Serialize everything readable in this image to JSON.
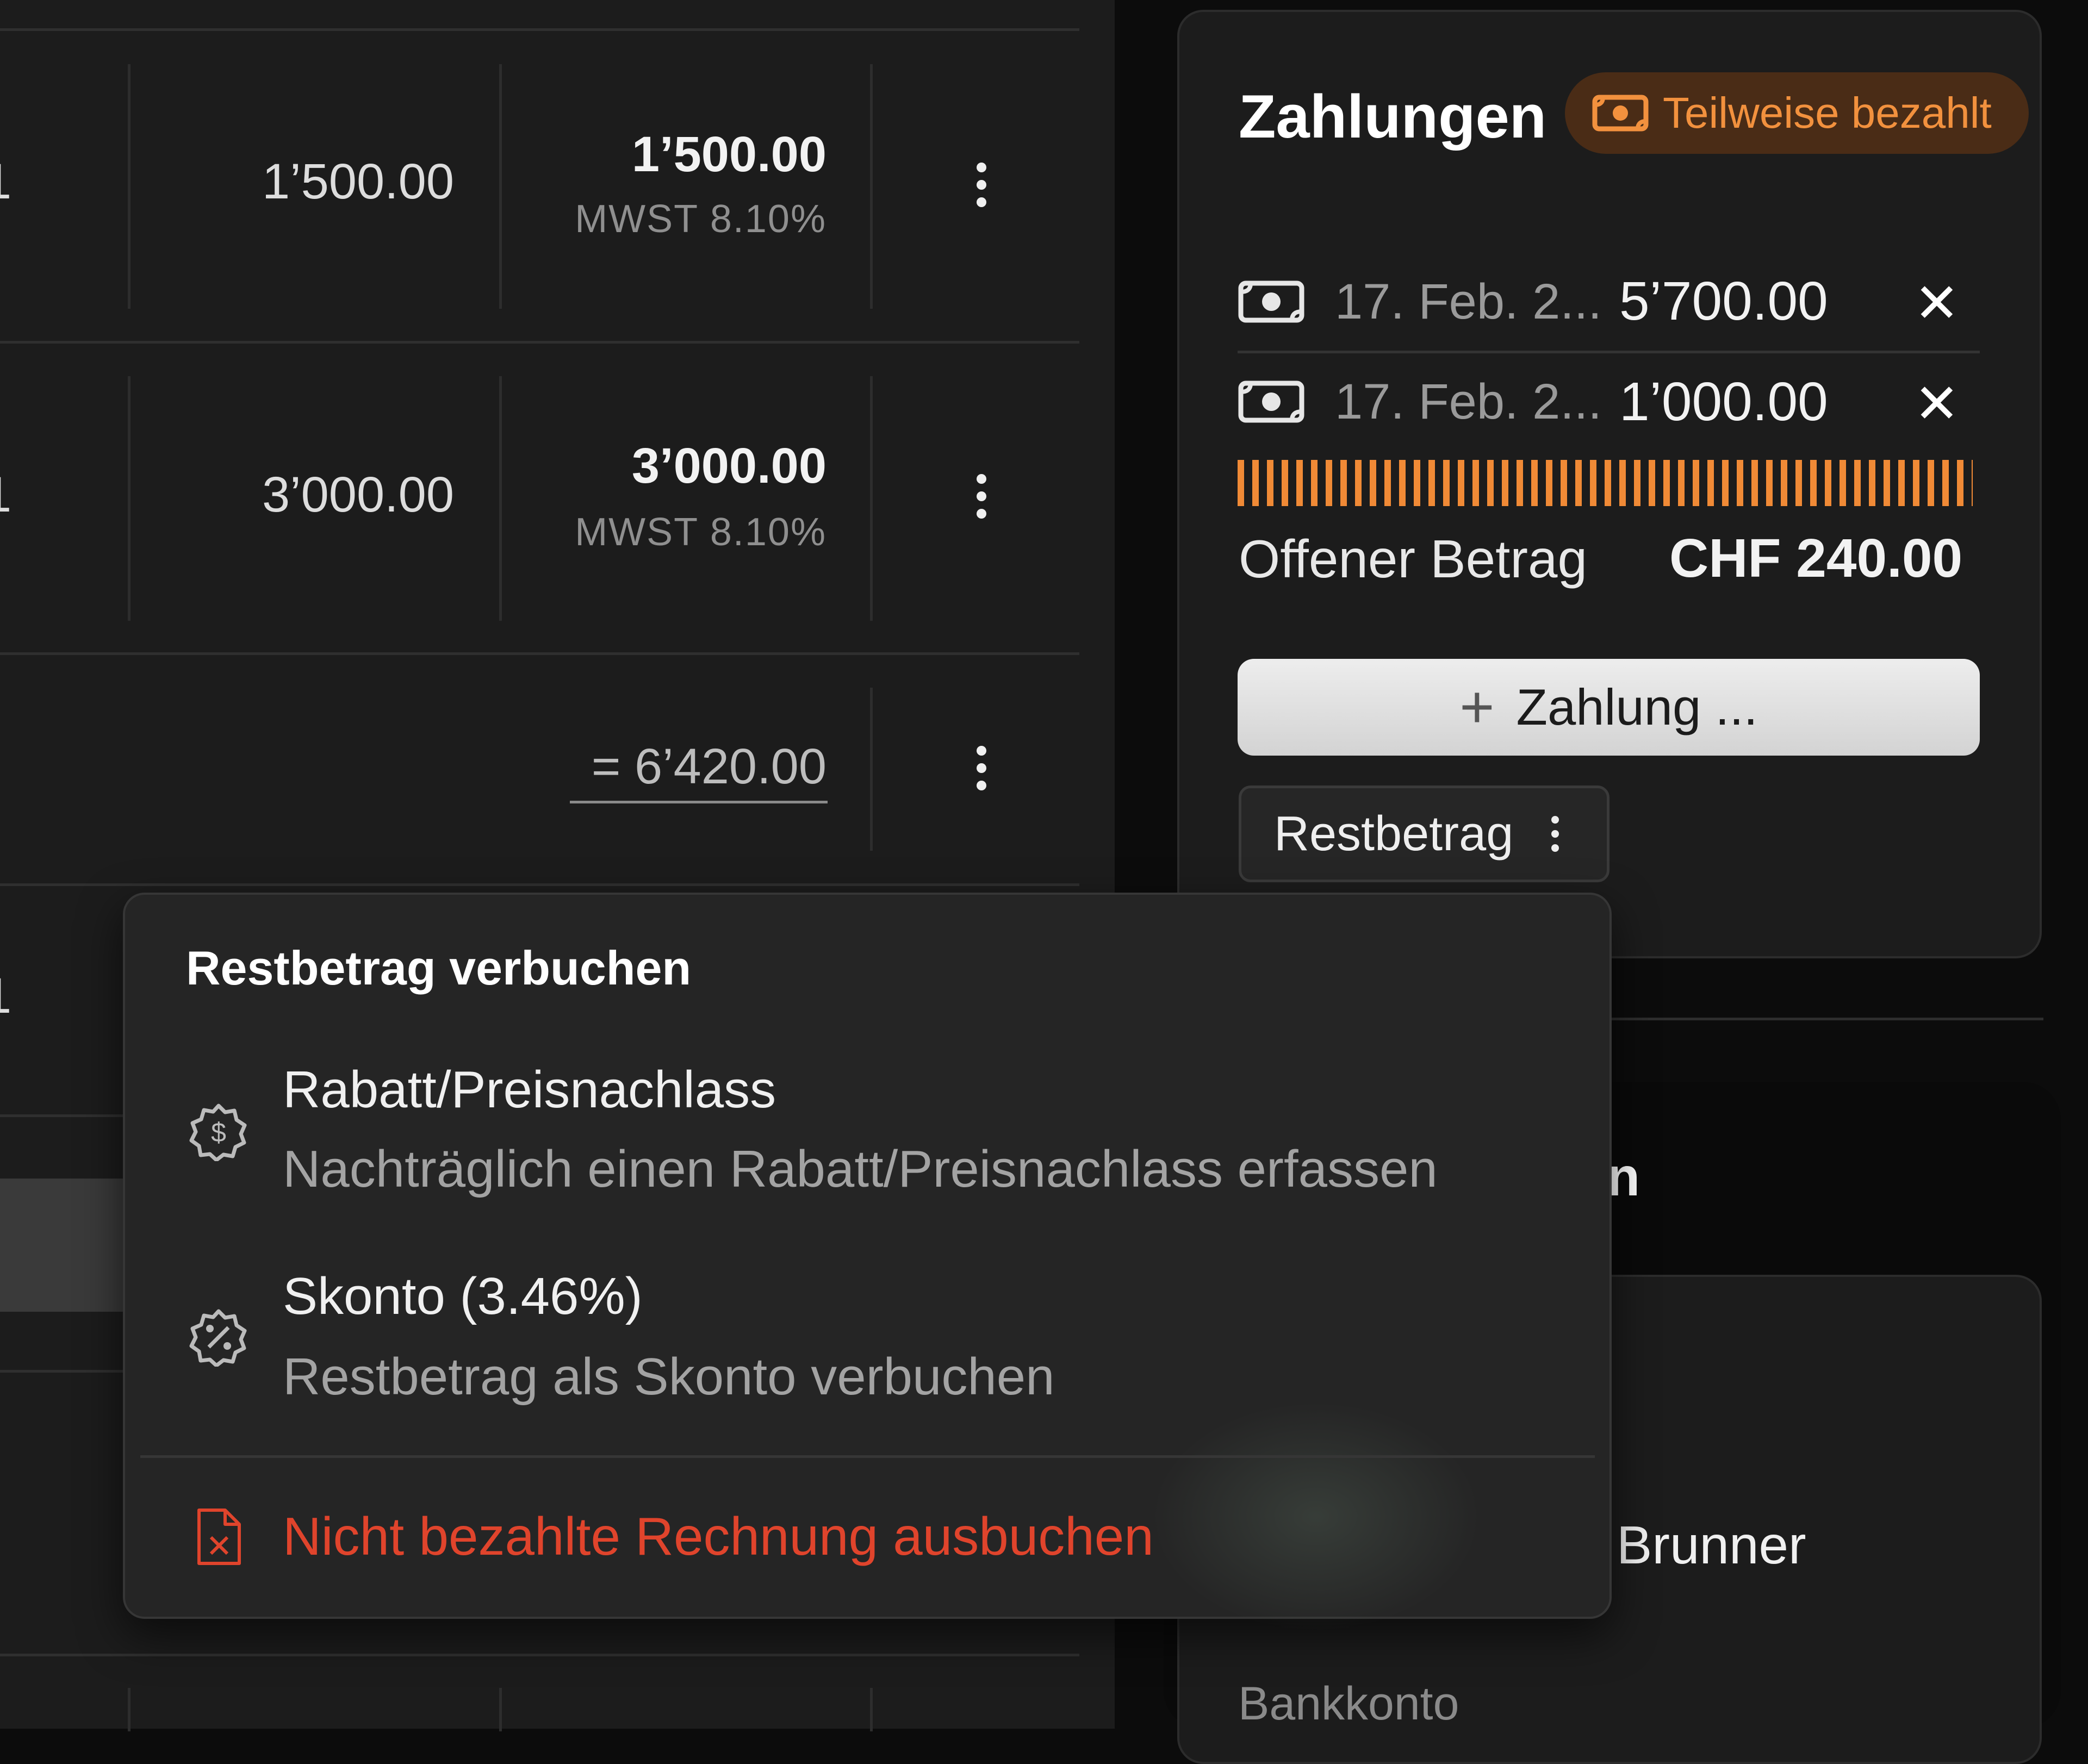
{
  "table": {
    "qty_1": "1",
    "qty_2": "1",
    "qty_3": "1",
    "row1": {
      "price": "1’500.00",
      "total": "1’500.00",
      "vat": "MWST 8.10%"
    },
    "row2": {
      "price": "3’000.00",
      "total": "3’000.00",
      "vat": "MWST 8.10%"
    },
    "sum": "= 6’420.00"
  },
  "payments": {
    "title": "Zahlungen",
    "status_badge": "Teilweise bezahlt",
    "entries": [
      {
        "date": "17. Feb. 2...",
        "amount": "5’700.00",
        "remove": "✕"
      },
      {
        "date": "17. Feb. 2...",
        "amount": "1’000.00",
        "remove": "✕"
      }
    ],
    "paid_fraction": 0.964,
    "open_label": "Offener Betrag",
    "open_amount": "CHF 240.00",
    "add_plus": "+",
    "add_button": "Zahlung ...",
    "rest_button": "Restbetrag"
  },
  "background_card": {
    "heading_fragment": "n",
    "name_fragment": "Brunner",
    "bank_label": "Bankkonto"
  },
  "menu": {
    "title": "Restbetrag verbuchen",
    "options": [
      {
        "icon": "discount-badge-icon",
        "title": "Rabatt/Preisnachlass",
        "desc": "Nachträglich einen Rabatt/Preisnachlass erfassen"
      },
      {
        "icon": "percent-badge-icon",
        "title": "Skonto (3.46%)",
        "desc": "Restbetrag als Skonto verbuchen"
      }
    ],
    "danger_action": {
      "icon": "file-x-icon",
      "label": "Nicht bezahlte Rechnung ausbuchen",
      "color": "#e0442c"
    }
  },
  "colors": {
    "accent": "#f08a36",
    "badge_bg": "#4a2c16",
    "danger": "#e0442c"
  }
}
